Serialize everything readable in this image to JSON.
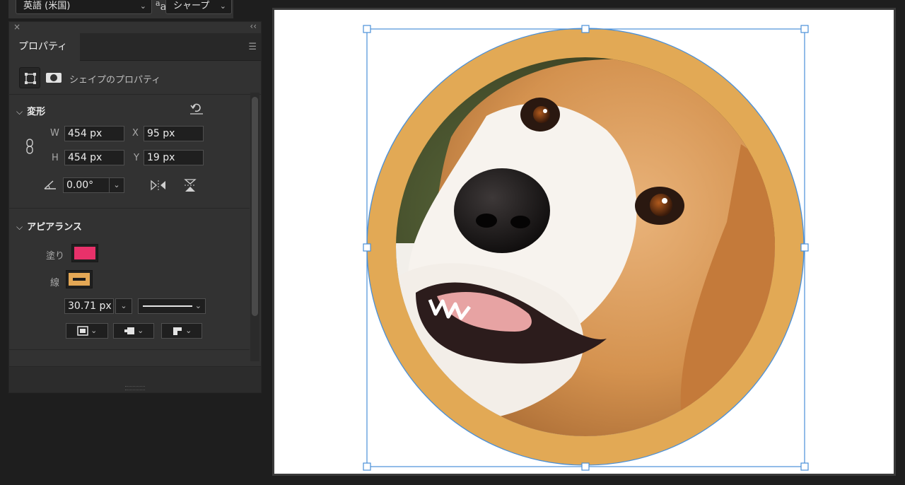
{
  "top": {
    "language_value": "英語 (米国)",
    "aa_label": "a",
    "aa_sub": "a",
    "antialias_value": "シャープ"
  },
  "properties_panel": {
    "close_glyph": "×",
    "collapse_glyph": "‹‹",
    "tab_label": "プロパティ",
    "shape_properties_title": "シェイプのプロパティ",
    "transform": {
      "title": "変形",
      "w_label": "W",
      "w_value": "454 px",
      "x_label": "X",
      "x_value": "95 px",
      "h_label": "H",
      "h_value": "454 px",
      "y_label": "Y",
      "y_value": "19 px",
      "angle_value": "0.00°"
    },
    "appearance": {
      "title": "アピアランス",
      "fill_label": "塗り",
      "fill_color": "#e8316a",
      "stroke_label": "線",
      "stroke_color": "#e3a755",
      "stroke_width_value": "30.71 px"
    }
  },
  "canvas": {
    "background": "#ffffff",
    "ring_color": "#e2a955",
    "selection_color": "#4a90d9",
    "image_subject": "beagle dog face"
  }
}
